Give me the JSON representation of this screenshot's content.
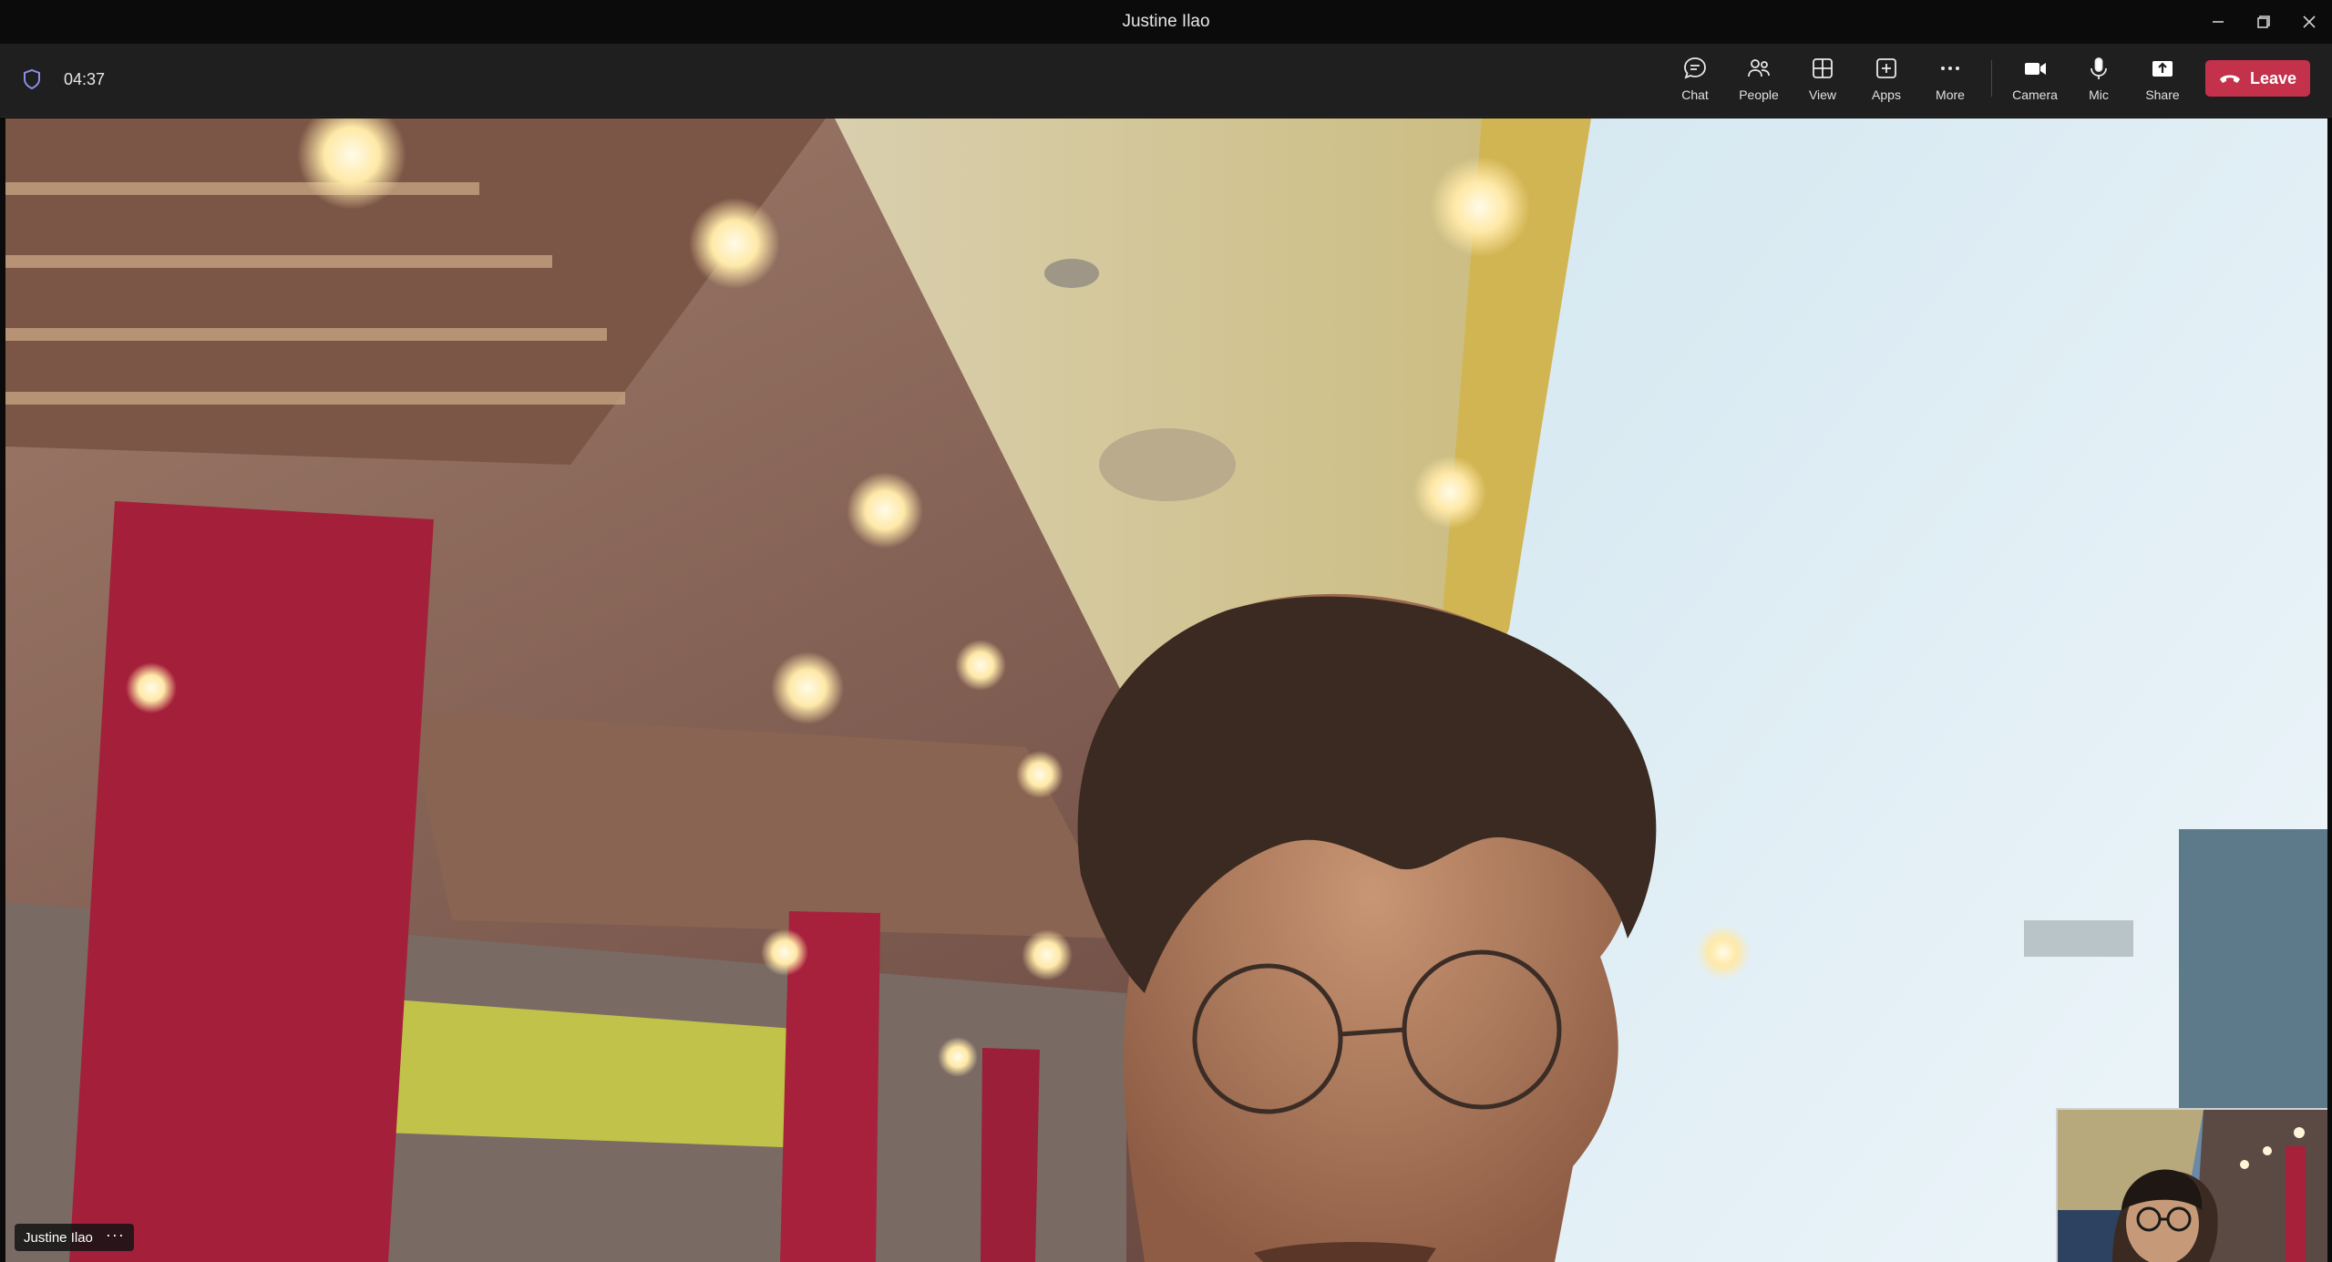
{
  "window": {
    "title": "Justine Ilao"
  },
  "meeting": {
    "timer": "04:37",
    "participant_name": "Justine Ilao",
    "more_options": "···"
  },
  "toolbar": {
    "chat": "Chat",
    "people": "People",
    "view": "View",
    "apps": "Apps",
    "more": "More",
    "camera": "Camera",
    "mic": "Mic",
    "share": "Share",
    "leave": "Leave"
  },
  "colors": {
    "leave_button": "#c4314b",
    "shield_icon": "#8b8fe6",
    "toolbar_bg": "#1f1f1f"
  }
}
